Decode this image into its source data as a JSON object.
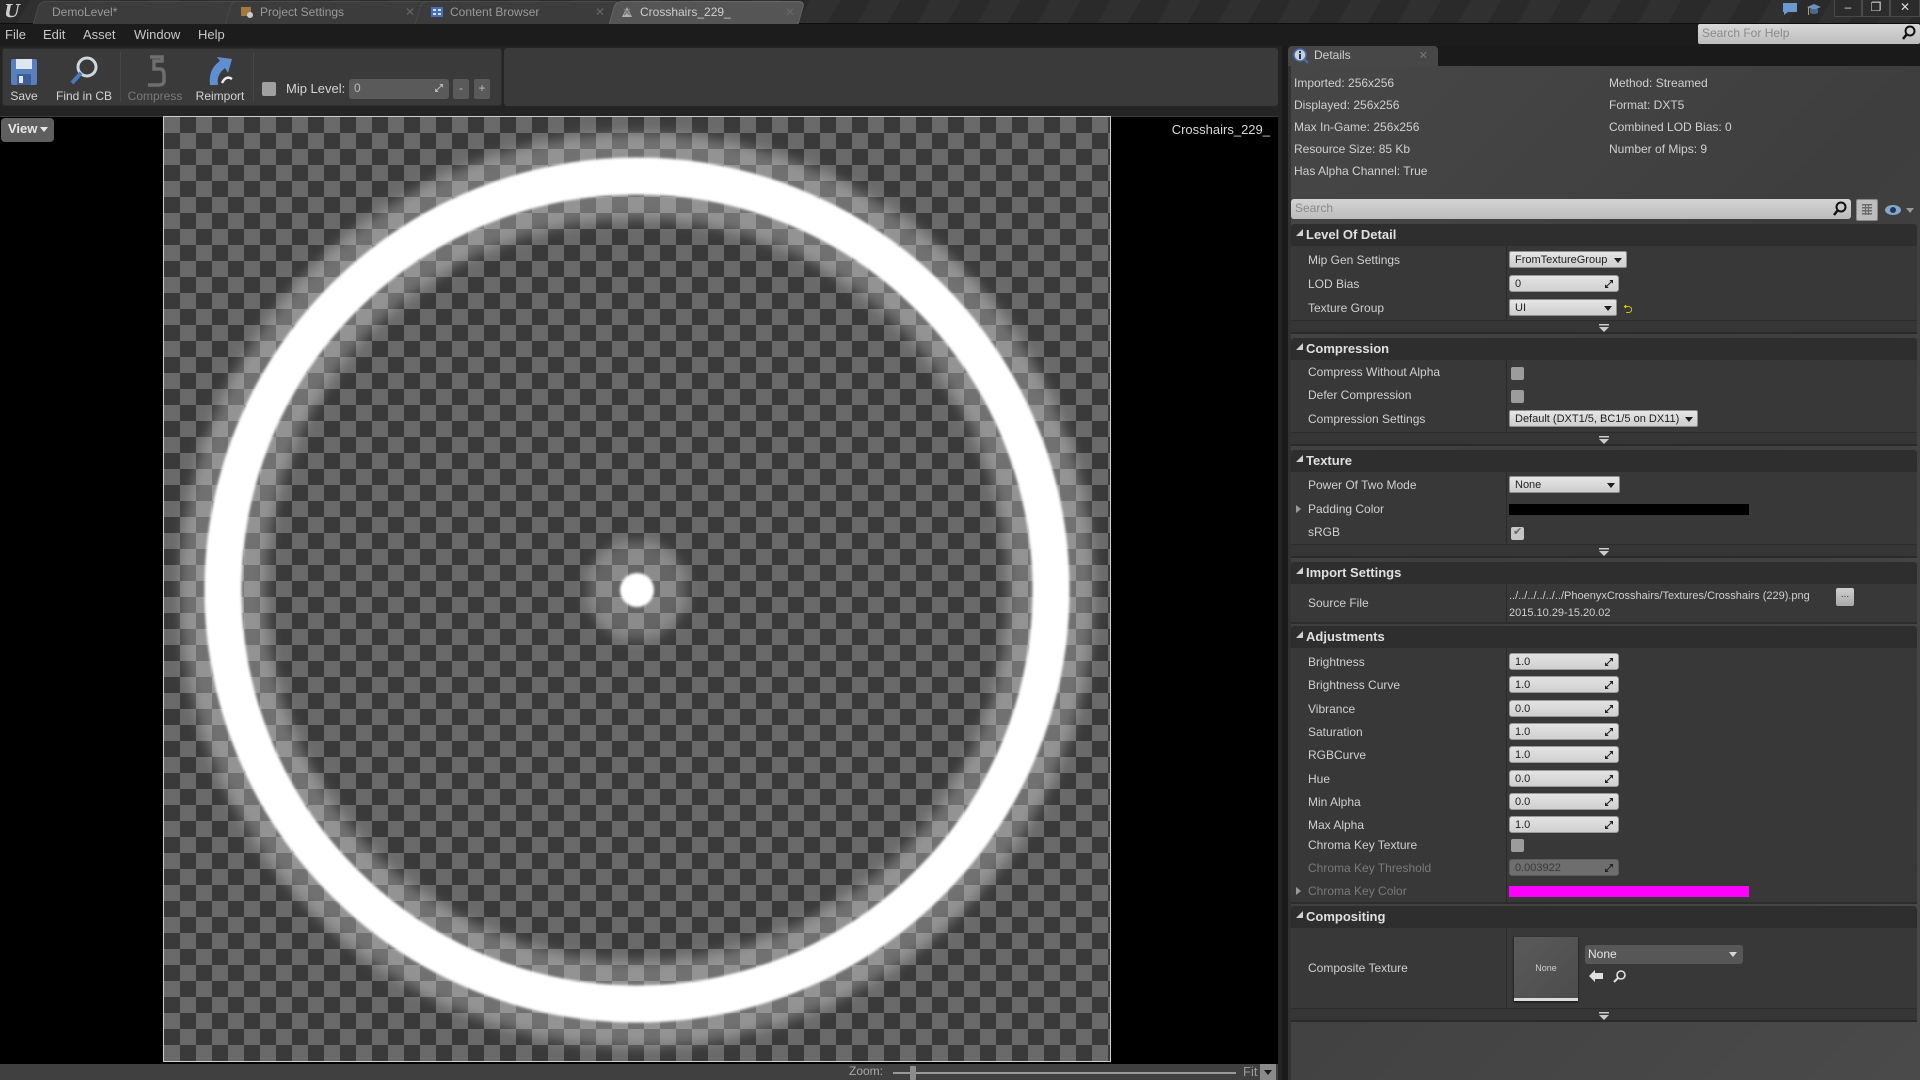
{
  "app": {
    "tabs": [
      {
        "label": "DemoLevel*",
        "icon": "ue-level-icon",
        "active": false
      },
      {
        "label": "Project Settings",
        "icon": "settings-icon",
        "active": false
      },
      {
        "label": "Content Browser",
        "icon": "content-browser-icon",
        "active": false
      },
      {
        "label": "Crosshairs_229_",
        "icon": "texture-icon",
        "active": true
      }
    ],
    "window_controls": {
      "minimize": "–",
      "restore": "❐",
      "close": "✕"
    },
    "help_search_placeholder": "Search For Help"
  },
  "menu": [
    "File",
    "Edit",
    "Asset",
    "Window",
    "Help"
  ],
  "toolbar": {
    "buttons": [
      {
        "label": "Save",
        "icon": "save-icon",
        "enabled": true
      },
      {
        "label": "Find in CB",
        "icon": "find-in-content-browser-icon",
        "enabled": true
      },
      {
        "label": "Compress",
        "icon": "compress-icon",
        "enabled": false
      },
      {
        "label": "Reimport",
        "icon": "reimport-icon",
        "enabled": true
      }
    ],
    "mip_checkbox_checked": false,
    "mip_level_label": "Mip Level:",
    "mip_level_value": "0",
    "mip_minus": "-",
    "mip_plus": "+"
  },
  "viewport": {
    "view_button": "View",
    "texture_name": "Crosshairs_229_",
    "zoom_label": "Zoom:",
    "zoom_mode": "Fit",
    "zoom_slider_fraction": 0.05
  },
  "details": {
    "tab_label": "Details",
    "info_left": [
      "Imported: 256x256",
      "Displayed: 256x256",
      "Max In-Game: 256x256",
      "Resource Size: 85 Kb",
      "Has Alpha Channel: True"
    ],
    "info_right": [
      "Method: Streamed",
      "Format: DXT5",
      "Combined LOD Bias: 0",
      "Number of Mips: 9"
    ],
    "search_placeholder": "Search",
    "sections": {
      "lod": {
        "title": "Level Of Detail",
        "mip_gen_settings": {
          "label": "Mip Gen Settings",
          "value": "FromTextureGroup"
        },
        "lod_bias": {
          "label": "LOD Bias",
          "value": "0"
        },
        "texture_group": {
          "label": "Texture Group",
          "value": "UI",
          "reset_icon": "⮌"
        }
      },
      "compression": {
        "title": "Compression",
        "compress_without_alpha": {
          "label": "Compress Without Alpha",
          "checked": false
        },
        "defer_compression": {
          "label": "Defer Compression",
          "checked": false
        },
        "compression_settings": {
          "label": "Compression Settings",
          "value": "Default (DXT1/5, BC1/5 on DX11)"
        }
      },
      "texture": {
        "title": "Texture",
        "power_of_two_mode": {
          "label": "Power Of Two Mode",
          "value": "None"
        },
        "padding_color": {
          "label": "Padding Color",
          "color": "#000000"
        },
        "srgb": {
          "label": "sRGB",
          "checked": true
        }
      },
      "import": {
        "title": "Import Settings",
        "source_file": {
          "label": "Source File",
          "path": "../../../../../../PhoenyxCrosshairs/Textures/Crosshairs (229).png",
          "timestamp": "2015.10.29-15.20.02",
          "browse_label": "..."
        }
      },
      "adjustments": {
        "title": "Adjustments",
        "rows": [
          {
            "label": "Brightness",
            "value": "1.0"
          },
          {
            "label": "Brightness Curve",
            "value": "1.0"
          },
          {
            "label": "Vibrance",
            "value": "0.0"
          },
          {
            "label": "Saturation",
            "value": "1.0"
          },
          {
            "label": "RGBCurve",
            "value": "1.0"
          },
          {
            "label": "Hue",
            "value": "0.0"
          },
          {
            "label": "Min Alpha",
            "value": "0.0"
          },
          {
            "label": "Max Alpha",
            "value": "1.0"
          }
        ],
        "chroma_key_texture": {
          "label": "Chroma Key Texture",
          "checked": false
        },
        "chroma_key_threshold": {
          "label": "Chroma Key Threshold",
          "value": "0.003922"
        },
        "chroma_key_color": {
          "label": "Chroma Key Color",
          "color": "#ff00ff"
        }
      },
      "compositing": {
        "title": "Compositing",
        "composite_texture": {
          "label": "Composite Texture",
          "thumbnail_text": "None",
          "value": "None"
        }
      }
    }
  }
}
